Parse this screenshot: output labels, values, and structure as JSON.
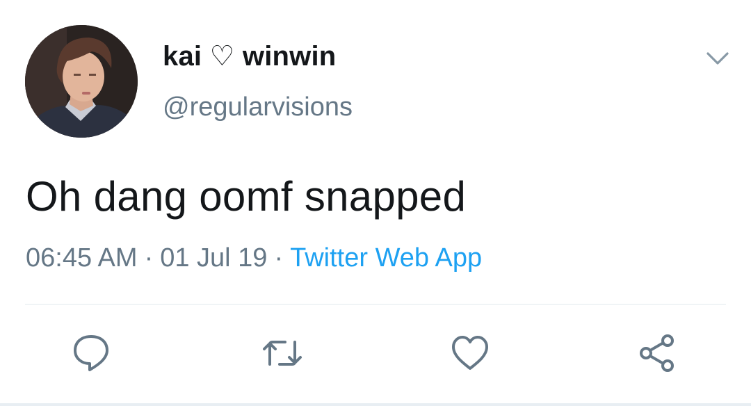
{
  "tweet": {
    "display_name": "kai ♡ winwin",
    "handle": "@regularvisions",
    "text": "Oh dang oomf snapped",
    "time": "06:45 AM",
    "date": "01 Jul 19",
    "separator": "·",
    "source": "Twitter Web App"
  },
  "icons": {
    "menu": "chevron-down-icon",
    "reply": "reply-icon",
    "retweet": "retweet-icon",
    "like": "heart-icon",
    "share": "share-icon"
  },
  "colors": {
    "text": "#14171a",
    "secondary": "#657786",
    "link": "#1da1f2",
    "divider": "#e1e8ed"
  }
}
